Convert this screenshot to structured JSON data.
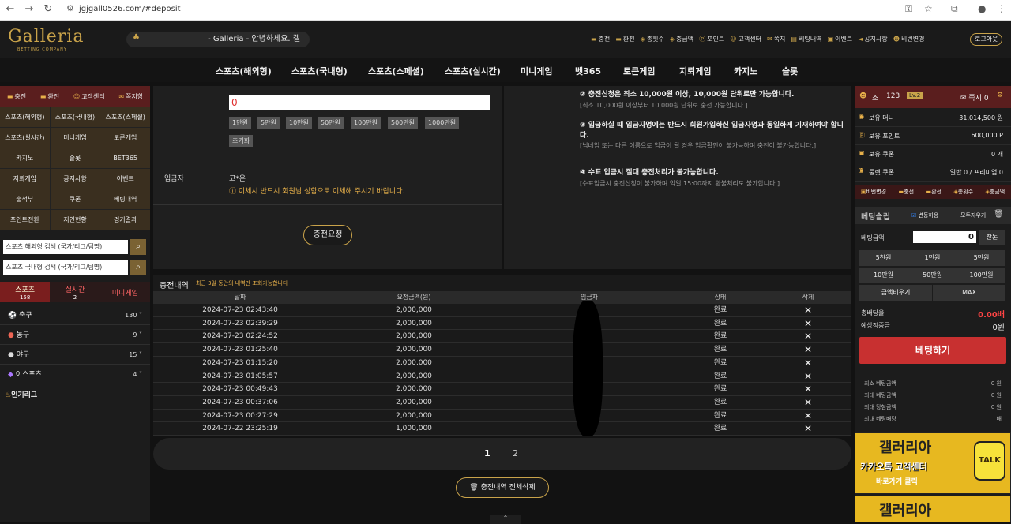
{
  "browser": {
    "url": "jgjgall0526.com/#deposit"
  },
  "header": {
    "logo": "Galleria",
    "logo_sub": "BETTING COMPANY",
    "notice": "- Galleria - 안녕하세요. 겔",
    "links": [
      "충전",
      "환전",
      "총횟수",
      "충금액",
      "포인트",
      "고객센터",
      "쪽지",
      "베팅내역",
      "이벤트",
      "공지사항",
      "비번변경"
    ],
    "logout": "로그아웃"
  },
  "nav": [
    "스포츠(해외형)",
    "스포츠(국내형)",
    "스포츠(스페셜)",
    "스포츠(실시간)",
    "미니게임",
    "벳365",
    "토큰게임",
    "지뢰게임",
    "카지노",
    "슬롯"
  ],
  "left": {
    "head": [
      "충전",
      "환전",
      "고객센터",
      "쪽지함"
    ],
    "grid": [
      "스포츠(해외형)",
      "스포츠(국내형)",
      "스포츠(스페셜)",
      "스포츠(실시간)",
      "미니게임",
      "토큰게임",
      "카지노",
      "슬롯",
      "BET365",
      "지뢰게임",
      "공지사항",
      "이벤트",
      "출석부",
      "쿠폰",
      "베팅내역",
      "포인트전환",
      "지인현황",
      "경기결과"
    ],
    "search1": "스포츠 해외형 검색 (국가/리그/팀명)",
    "search2": "스포츠 국내형 검색 (국가/리그/팀명)",
    "tabs": [
      {
        "label": "스포츠",
        "count": "158"
      },
      {
        "label": "실시간",
        "count": "2"
      },
      {
        "label": "미니게임",
        "count": ""
      }
    ],
    "sports": [
      {
        "name": "축구",
        "count": "130"
      },
      {
        "name": "농구",
        "count": "9"
      },
      {
        "name": "야구",
        "count": "15"
      },
      {
        "name": "이스포츠",
        "count": "4"
      }
    ],
    "popular": "인기리그"
  },
  "form": {
    "amount": "0",
    "amounts": [
      "1만원",
      "5만원",
      "10만원",
      "50만원",
      "100만원",
      "500만원",
      "1000만원"
    ],
    "reset": "초기화",
    "depositor_label": "입금자",
    "depositor_name": "고*은",
    "warning": "이체시 반드시 회원님 성함으로 이체해 주시기 바랍니다.",
    "submit": "충전요청"
  },
  "rules": [
    {
      "title": "② 충전신청은 최소 10,000원 이상, 10,000원 단위로만 가능합니다.",
      "note": "[최소 10,000원 이상부터 10,000원 단위로 충전 가능합니다.]"
    },
    {
      "title": "③ 입금하실 때 입금자명에는 반드시 회원가입하신 입금자명과 동일하게 기재하여야 합니다.",
      "note": "[닉네임 또는 다른 이름으로 입금이 될 경우 입금확인이 불가능하며 충전이 불가능합니다.]"
    },
    {
      "title": "④ 수표 입금시 절대 충전처리가 불가능합니다.",
      "note": "[수표입금시 충전신청이 불가하며 익일 15:00까지 환불처리도 불가합니다.]"
    }
  ],
  "history": {
    "title": "충전내역",
    "sub": "최근 3일 동안의 내역만 조회가능합니다",
    "columns": [
      "날짜",
      "요청금액(원)",
      "입금자",
      "상태",
      "삭제"
    ],
    "rows": [
      {
        "date": "2024-07-23 02:43:40",
        "amount": "2,000,000",
        "status": "완료"
      },
      {
        "date": "2024-07-23 02:39:29",
        "amount": "2,000,000",
        "status": "완료"
      },
      {
        "date": "2024-07-23 02:24:52",
        "amount": "2,000,000",
        "status": "완료"
      },
      {
        "date": "2024-07-23 01:25:40",
        "amount": "2,000,000",
        "status": "완료"
      },
      {
        "date": "2024-07-23 01:15:20",
        "amount": "2,000,000",
        "status": "완료"
      },
      {
        "date": "2024-07-23 01:05:57",
        "amount": "2,000,000",
        "status": "완료"
      },
      {
        "date": "2024-07-23 00:49:43",
        "amount": "2,000,000",
        "status": "완료"
      },
      {
        "date": "2024-07-23 00:37:06",
        "amount": "2,000,000",
        "status": "완료"
      },
      {
        "date": "2024-07-23 00:27:29",
        "amount": "2,000,000",
        "status": "완료"
      },
      {
        "date": "2024-07-22 23:25:19",
        "amount": "1,000,000",
        "status": "완료"
      }
    ],
    "pages": [
      "1",
      "2"
    ],
    "delete_all": "충전내역 전체삭제"
  },
  "user": {
    "name": "조",
    "id": "123",
    "level": "Lv.2",
    "msg_label": "쪽지",
    "msg_count": "0",
    "money_label": "보유 머니",
    "money": "31,014,500 원",
    "point_label": "보유 포인트",
    "point": "600,000 P",
    "coupon_label": "보유 쿠폰",
    "coupon": "0 개",
    "roulette_label": "룰렛 쿠폰",
    "roulette": "일반 0 / 프리미엄 0",
    "actions": [
      "비번변경",
      "충전",
      "환전",
      "총횟수",
      "충금액"
    ]
  },
  "slip": {
    "title": "베팅슬립",
    "toggle": "변동허용",
    "clear": "모두지우기",
    "amount_label": "베팅금액",
    "amount": "0",
    "allin": "잔돈",
    "buttons": [
      "5천원",
      "1만원",
      "5만원",
      "10만원",
      "50만원",
      "100만원",
      "금액비우기",
      "MAX"
    ],
    "odds_label": "총배당율",
    "odds": "0.00배",
    "win_label": "예상적중금",
    "win": "0원",
    "bet": "베팅하기",
    "limits": [
      {
        "label": "최소 베팅금액",
        "value": "0 원"
      },
      {
        "label": "최대 베팅금액",
        "value": "0 원"
      },
      {
        "label": "최대 당첨금액",
        "value": "0 원"
      },
      {
        "label": "최대 베팅배당",
        "value": "배"
      }
    ]
  },
  "banners": [
    {
      "title": "갤러리아",
      "sub": "카카오톡 고객센터",
      "cta": "바로가기 클릭",
      "badge": "TALK"
    },
    {
      "title": "갤러리아"
    }
  ],
  "colors": {
    "gold": "#c9a34a",
    "dark_red": "#5a1e1e",
    "bet_red": "#c83030"
  }
}
